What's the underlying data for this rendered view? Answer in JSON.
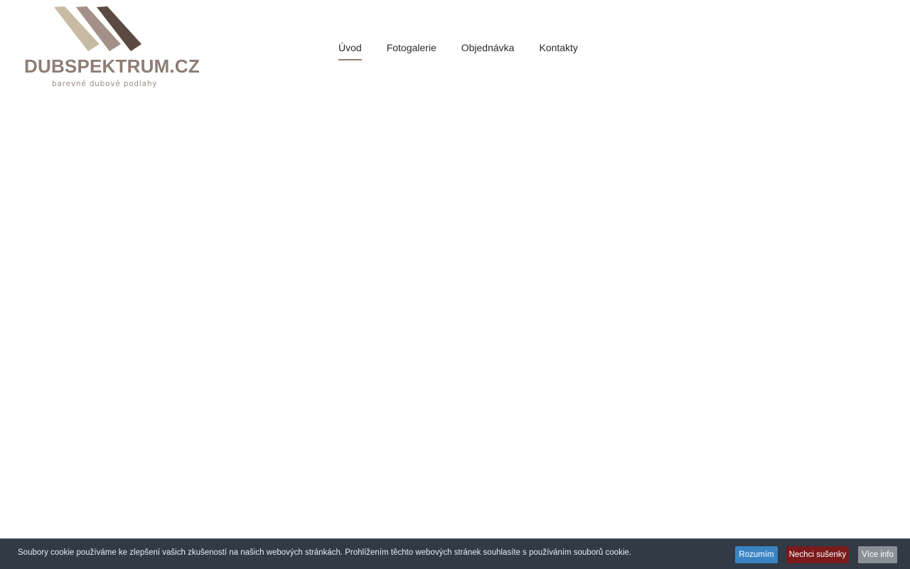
{
  "site": {
    "logo_name": "DUBSPEKTRUM.CZ",
    "logo_tagline": "barevné dubové podlahy",
    "logo_colors": [
      "#c8bba3",
      "#a39088",
      "#5a4a42"
    ]
  },
  "nav": {
    "items": [
      {
        "label": "Úvod",
        "active": true
      },
      {
        "label": "Fotogalerie",
        "active": false
      },
      {
        "label": "Objednávka",
        "active": false
      },
      {
        "label": "Kontakty",
        "active": false
      }
    ]
  },
  "cookie": {
    "text": "Soubory cookie používáme ke zlepšení vašich zkušeností na našich webových stránkách. Prohlížením těchto webových stránek souhlasíte s používáním souborů cookie.",
    "accept_label": "Rozumím",
    "decline_label": "Nechci sušenky",
    "info_label": "Více info"
  },
  "colors": {
    "accent": "#8e7d74",
    "cookie_bg": "#313a45",
    "accept_bg": "#3a83c2",
    "decline_bg": "#7a1a1a",
    "info_bg": "#8a9196"
  }
}
